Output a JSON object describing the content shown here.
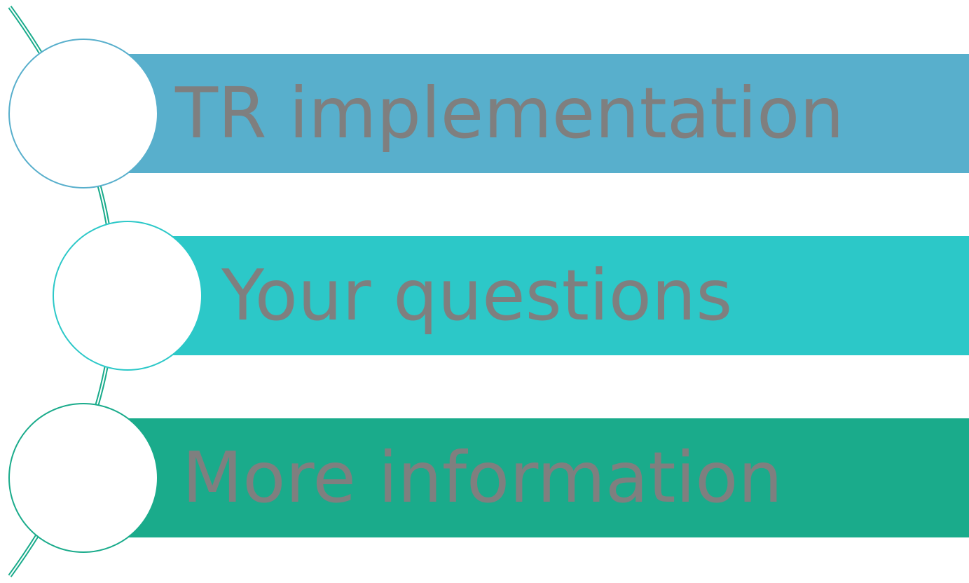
{
  "colors": {
    "background": "#ffffff",
    "connector": "#1aab8b",
    "label_text": "#7f7f7f"
  },
  "items": [
    {
      "label": "TR implementation",
      "band_color": "#58afcc",
      "ring_color": "#58afcc"
    },
    {
      "label": "Your questions",
      "band_color": "#2cc8c8",
      "ring_color": "#2cc8c8"
    },
    {
      "label": "More information",
      "band_color": "#1aab8b",
      "ring_color": "#1aab8b"
    }
  ]
}
